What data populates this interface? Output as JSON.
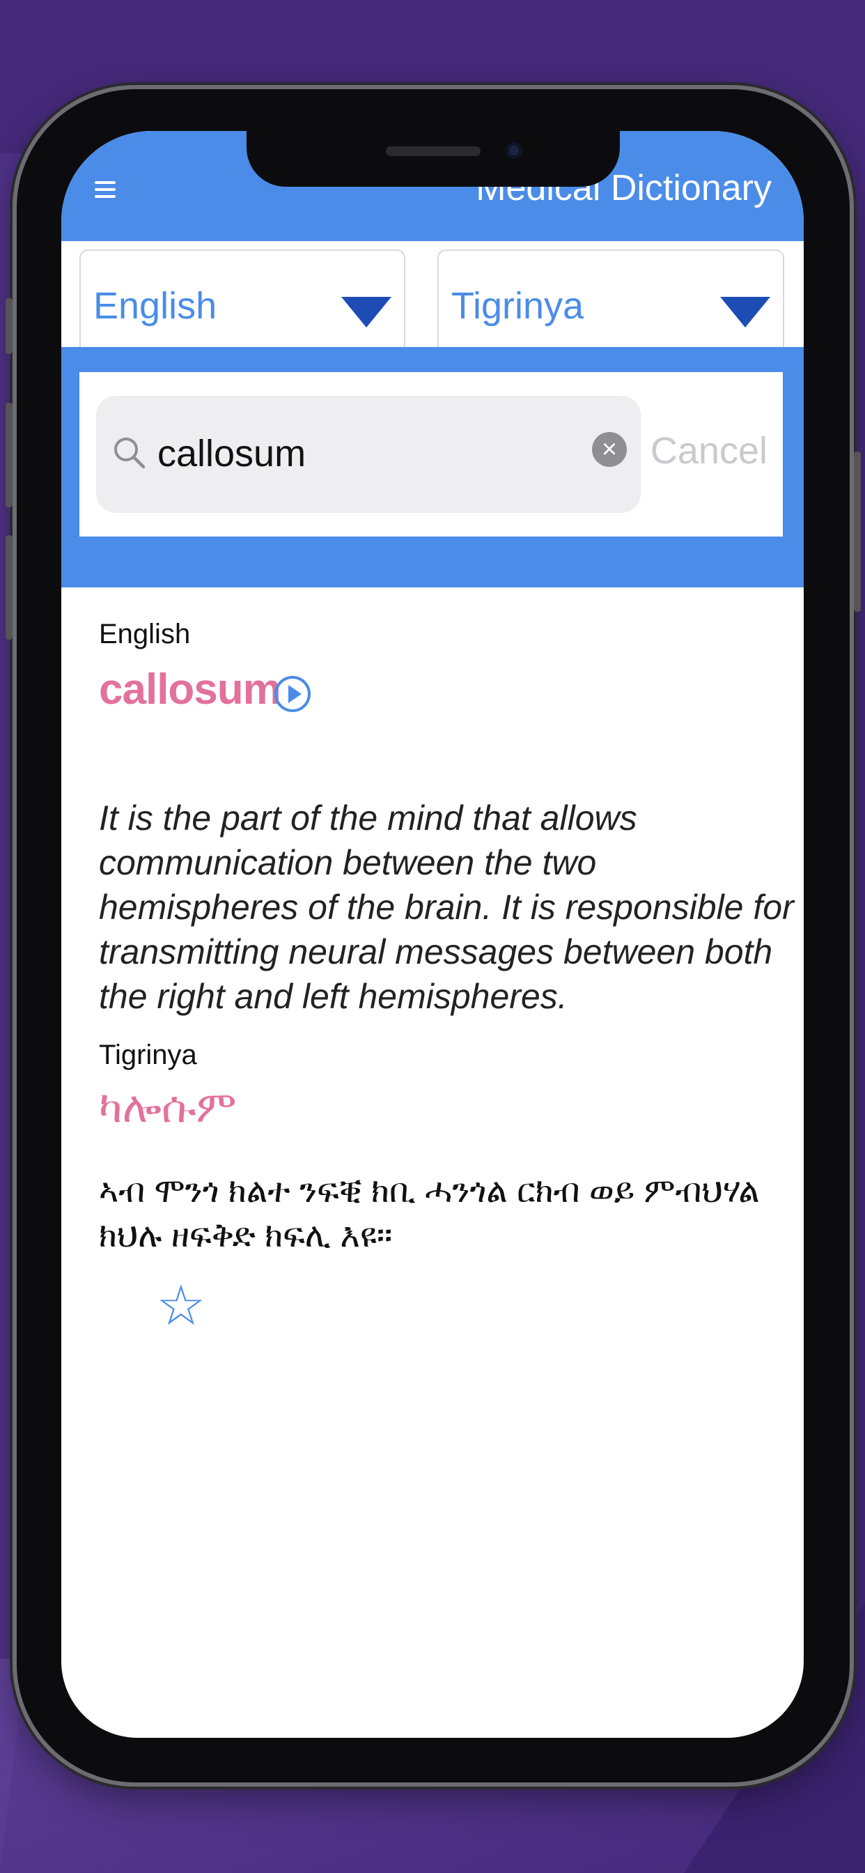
{
  "header": {
    "title": "Medical Dictionary",
    "menu_icon": "hamburger-menu-icon"
  },
  "languages": {
    "source": "English",
    "target": "Tigrinya",
    "dropdown_icon": "triangle-down-icon"
  },
  "search": {
    "query": "callosum",
    "cancel_label": "Cancel",
    "icon": "search-icon",
    "clear_icon": "clear-x-icon"
  },
  "result": {
    "source_language_label": "English",
    "term": "callosum",
    "play_icon": "play-audio-icon",
    "definition": "It is the part of the mind that allows communication between the two hemispheres of the brain. It is responsible for transmitting neural messages between both the right and left hemispheres.",
    "target_language_label": "Tigrinya",
    "term_translation": "ካሎሱም",
    "definition_translation": "ኣብ ሞንጎ ክልተ ንፍቒ ክቢ ሓንጎል ርክብ  ወይ ምብህሃል ክህሉ ዘፍቅድ ክፍሊ እዩ።",
    "favorite_icon": "star-outline-icon"
  },
  "colors": {
    "accent": "#4a8ce8",
    "term": "#e2729a",
    "dropdown": "#1e4cb5",
    "background": "#45297a"
  }
}
